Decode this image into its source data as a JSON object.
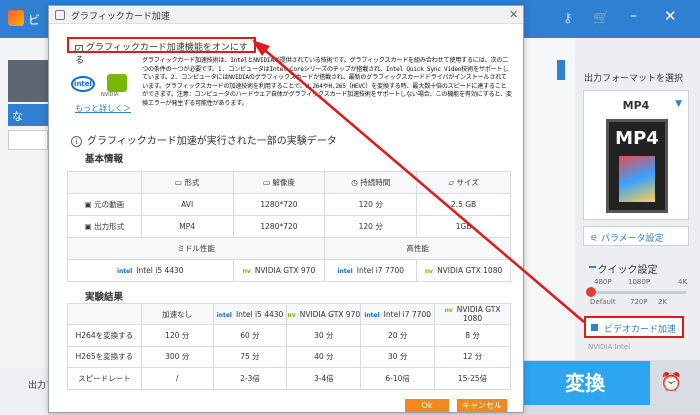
{
  "app": {
    "title": "ビ",
    "left_tab": "な",
    "output_label": "出力フ",
    "convert_label": "変換"
  },
  "right_panel": {
    "title": "出力フォーマットを選択",
    "format": "MP4",
    "format_icon_text": "MP4",
    "param_label": "パラメータ設定",
    "quick_label": "クイック設定",
    "res_top": [
      "480P",
      "1080P",
      "4K"
    ],
    "res_bottom": [
      "Default",
      "720P",
      "2K"
    ],
    "gpu_label": "ビデオカード加速",
    "brands": "NVIDIA  Intel"
  },
  "dialog": {
    "title": "グラフィックカード加速",
    "checkbox_label": "グラフィックカード加速機能をオンにする",
    "more_link": "もっと詳しく＞",
    "logo_intel": "intel",
    "logo_nvidia": "NVIDIA",
    "description": "グラフィックカード加速技術は、IntelとNVIDIAが提供されている技術です。グラフィックスカードを組み合わせて使用するには、次の二つの条件の一つが必要です。1. コンピュータはIntel Coreシリーズのチップが搭載され、Intel Quick Sync Video技術をサポートしています。2. コンピュータにはNVIDIAのグラフィックスカードが搭載され、最新のグラフィックスカードドライバがインストールされています。グラフィックスカードの加速技術を利用することで、H.264やH.265（HEVC）を変換する時、最大数十倍のスピードに達することができます。注意：コンピュータのハードウェア自体がグラフィックスカード加速技術をサポートしない場合、この機能を有効にすると、変換エラーが発生する可能性があります。",
    "data_heading": "グラフィックカード加速が実行された一部の実験データ",
    "section_info": "基本情報",
    "section_results": "実験結果",
    "ok": "Ok",
    "cancel": "キャンセル",
    "info_table": {
      "headers": [
        "形式",
        "解像度",
        "持続時間",
        "サイズ"
      ],
      "rows": [
        {
          "label": "元の動画",
          "values": [
            "AVI",
            "1280*720",
            "120 分",
            "2.5 GB"
          ]
        },
        {
          "label": "出力形式",
          "values": [
            "MP4",
            "1280*720",
            "120 分",
            "1GB"
          ]
        }
      ],
      "perf_mid": "ミドル性能",
      "perf_high": "高性能",
      "hardware": [
        "Intel i5 4430",
        "NVIDIA GTX 970",
        "Intel i7 7700",
        "NVIDIA GTX 1080"
      ]
    },
    "result_table": {
      "headers": [
        "加速なし",
        "Intel i5 4430",
        "NVIDIA GTX 970",
        "Intel i7 7700",
        "NVIDIA GTX 1080"
      ],
      "rows": [
        {
          "label": "H264を変換する",
          "values": [
            "120 分",
            "60 分",
            "30 分",
            "20 分",
            "8 分"
          ]
        },
        {
          "label": "H265を変換する",
          "values": [
            "300 分",
            "75 分",
            "40 分",
            "30 分",
            "12 分"
          ]
        },
        {
          "label": "スピードレート",
          "values": [
            "/",
            "2-3倍",
            "3-4倍",
            "6-10倍",
            "15-25倍"
          ]
        }
      ]
    }
  }
}
